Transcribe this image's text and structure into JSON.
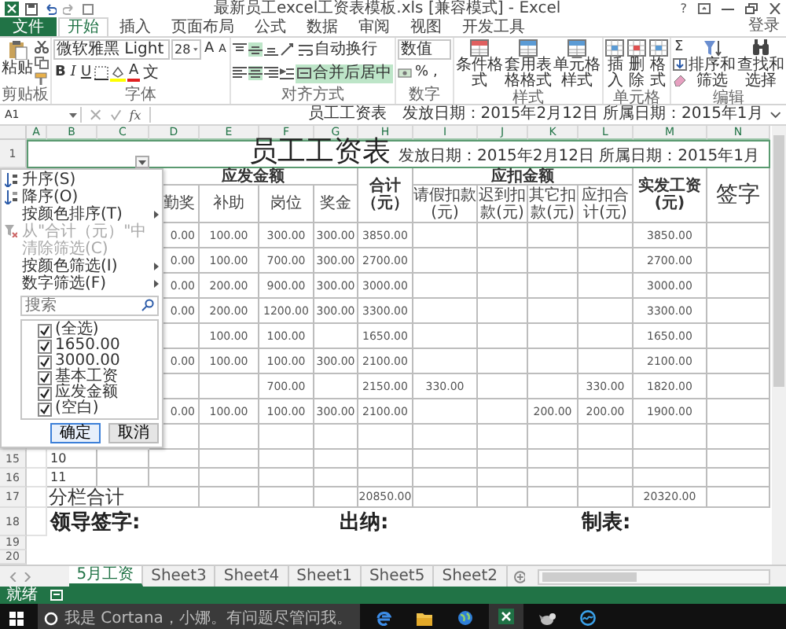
{
  "window": {
    "title": "最新员工excel工资表模板.xls [兼容模式] - Excel",
    "help": "?",
    "sign_in": "登录"
  },
  "ribbon_tabs": [
    {
      "label": "文件",
      "kind": "file",
      "selected": false
    },
    {
      "label": "开始",
      "kind": "tab",
      "selected": true
    },
    {
      "label": "插入",
      "kind": "tab",
      "selected": false
    },
    {
      "label": "页面布局",
      "kind": "tab",
      "selected": false
    },
    {
      "label": "公式",
      "kind": "tab",
      "selected": false
    },
    {
      "label": "数据",
      "kind": "tab",
      "selected": false
    },
    {
      "label": "审阅",
      "kind": "tab",
      "selected": false
    },
    {
      "label": "视图",
      "kind": "tab",
      "selected": false
    },
    {
      "label": "开发工具",
      "kind": "tab",
      "selected": false
    }
  ],
  "ribbon": {
    "clipboard": {
      "label": "剪贴板",
      "paste": "粘贴"
    },
    "font": {
      "label": "字体",
      "name": "微软雅黑 Light",
      "size": "28",
      "grow": "A",
      "shrink": "A",
      "bold": "B",
      "italic": "I",
      "underline": "U",
      "color_button": "A",
      "phonetic": "文"
    },
    "alignment": {
      "label": "对齐方式",
      "wrap_text": "自动换行",
      "merge_center": "合并后居中",
      "center_selected": true,
      "merge_selected": true
    },
    "number": {
      "label": "数字",
      "format": "数值",
      "percent": "%",
      "comma": ","
    },
    "styles": {
      "label": "样式",
      "buttons": [
        "条件格式",
        "套用表格格式",
        "单元格样式"
      ]
    },
    "cells": {
      "label": "单元格",
      "buttons": [
        "插入",
        "删除",
        "格式"
      ]
    },
    "editing": {
      "label": "编辑",
      "sum": "Σ",
      "buttons": [
        "排序和筛选",
        "查找和选择"
      ]
    }
  },
  "formula_bar": {
    "name_box": "A1",
    "fx": "fx",
    "content": "员工工资表　发放日期：2015年2月12日 所属日期：2015年1月"
  },
  "sheet": {
    "columns": [
      "A",
      "B",
      "C",
      "D",
      "E",
      "F",
      "G",
      "H",
      "I",
      "J",
      "K",
      "L",
      "M",
      "N"
    ],
    "title_row": {
      "number": "1",
      "title": "员工工资表",
      "dates": "发放日期：2015年2月12日 所属日期：2015年1月"
    },
    "group_headers": [
      "应发金额",
      "应扣金额"
    ],
    "total_header": "合计（元）",
    "net_header": "实发工资(元)",
    "sign_header": "签字",
    "sub_headers": {
      "d": "勤奖",
      "e": "补助",
      "f": "岗位",
      "g": "奖金",
      "i": "请假扣款(元)",
      "j": "迟到扣款(元)",
      "k": "其它扣款(元)",
      "l": "应扣合计(元)"
    },
    "rows": [
      {
        "d": "0.00",
        "e": "100.00",
        "f": "300.00",
        "g": "300.00",
        "h": "3850.00",
        "m": "3850.00"
      },
      {
        "d": "0.00",
        "e": "100.00",
        "f": "700.00",
        "g": "300.00",
        "h": "2700.00",
        "m": "2700.00"
      },
      {
        "d": "0.00",
        "e": "200.00",
        "f": "900.00",
        "g": "300.00",
        "h": "3000.00",
        "m": "3000.00"
      },
      {
        "d": "0.00",
        "e": "200.00",
        "f": "1200.00",
        "g": "300.00",
        "h": "3300.00",
        "m": "3300.00"
      },
      {
        "e": "100.00",
        "f": "100.00",
        "h": "1650.00",
        "m": "1650.00"
      },
      {
        "d": "0.00",
        "e": "100.00",
        "f": "100.00",
        "g": "300.00",
        "h": "2100.00",
        "m": "2100.00"
      },
      {
        "f": "700.00",
        "h": "2150.00",
        "i": "330.00",
        "l": "330.00",
        "m": "1820.00"
      },
      {
        "d": "0.00",
        "e": "100.00",
        "f": "100.00",
        "g": "300.00",
        "h": "2100.00",
        "k": "200.00",
        "l": "200.00",
        "m": "1900.00"
      }
    ],
    "numbered_rows": [
      {
        "number": "15",
        "seq": "10"
      },
      {
        "number": "16",
        "seq": "11"
      }
    ],
    "total_row": {
      "number": "17",
      "label": "分栏合计",
      "total": "20850.00",
      "net": "20320.00"
    },
    "signature_row": {
      "number": "18",
      "leader": "领导签字:",
      "cashier": "出纳:",
      "preparer": "制表:"
    },
    "empty_row_numbers": [
      "19",
      "20"
    ]
  },
  "filter_panel": {
    "menu": [
      {
        "label": "升序(S)",
        "kind": "sort_ascending",
        "disabled": false
      },
      {
        "label": "降序(O)",
        "kind": "sort_descending",
        "disabled": false
      },
      {
        "label": "按颜色排序(T)",
        "kind": "submenu",
        "disabled": false
      },
      {
        "label": "从\"合计（元）\"中清除筛选(C)",
        "kind": "clear_filter",
        "disabled": true
      },
      {
        "label": "按颜色筛选(I)",
        "kind": "submenu",
        "disabled": false
      },
      {
        "label": "数字筛选(F)",
        "kind": "submenu",
        "disabled": false
      }
    ],
    "search_placeholder": "搜索",
    "values": [
      {
        "label": "(全选)",
        "checked": true
      },
      {
        "label": "1650.00",
        "checked": true
      },
      {
        "label": "3000.00",
        "checked": true
      },
      {
        "label": "基本工资",
        "checked": true
      },
      {
        "label": "应发金额",
        "checked": true
      },
      {
        "label": "(空白)",
        "checked": true
      }
    ],
    "ok": "确定",
    "cancel": "取消"
  },
  "sheet_tabs": [
    {
      "label": "5月工资",
      "selected": true
    },
    {
      "label": "Sheet3",
      "selected": false
    },
    {
      "label": "Sheet4",
      "selected": false
    },
    {
      "label": "Sheet1",
      "selected": false
    },
    {
      "label": "Sheet5",
      "selected": false
    },
    {
      "label": "Sheet2",
      "selected": false
    }
  ],
  "status_bar": {
    "text": "就绪"
  },
  "taskbar": {
    "search_placeholder": "我是 Cortana，小娜。有问题尽管问我。",
    "apps": [
      {
        "kind": "browser",
        "selected": false
      },
      {
        "kind": "folder",
        "selected": false
      },
      {
        "kind": "globe",
        "selected": false
      },
      {
        "kind": "spreadsheet",
        "selected": true
      },
      {
        "kind": "bird",
        "selected": false
      },
      {
        "kind": "media",
        "selected": false
      }
    ]
  }
}
